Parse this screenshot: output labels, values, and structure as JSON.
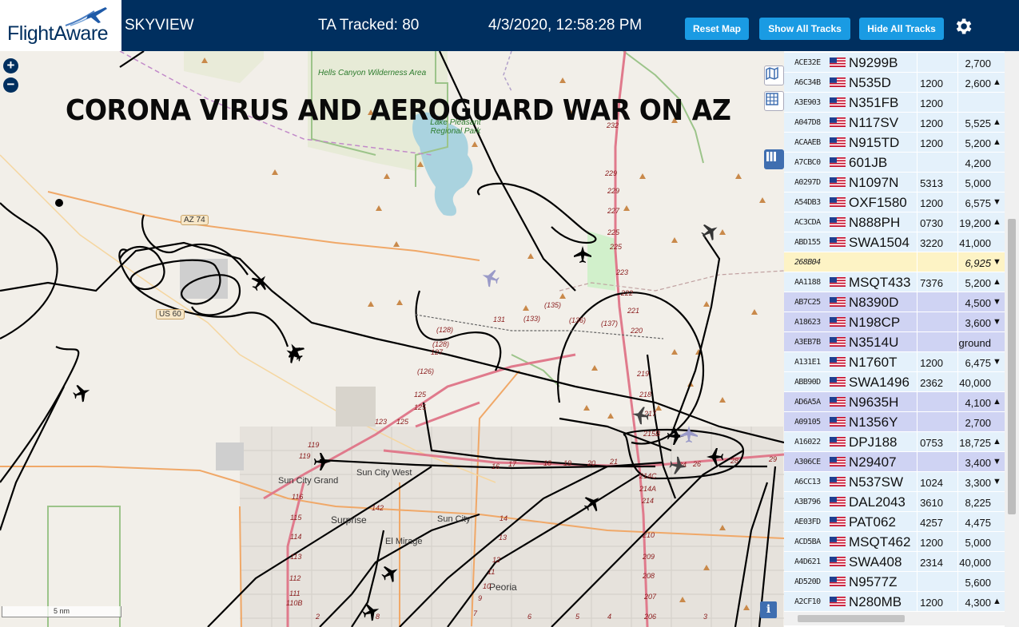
{
  "header": {
    "brand": "FlightAware",
    "app_name": "SKYVIEW",
    "tracked": "TA Tracked: 80",
    "datetime": "4/3/2020, 12:58:28 PM",
    "buttons": {
      "reset": "Reset Map",
      "show": "Show All Tracks",
      "hide": "Hide All Tracks"
    },
    "settings_icon": "gear-icon",
    "colors": {
      "bar": "#002f5f",
      "button": "#1a9be3"
    }
  },
  "map": {
    "overlay_title": "CORONA VIRUS AND AEROGUARD WAR ON AZ",
    "zoom_in": "+",
    "zoom_out": "−",
    "scale_label": "5 nm",
    "info_label": "i",
    "places": {
      "hells_canyon": "Hells Canyon Wilderness Area",
      "lake_pleasant": "Lake Pleasant Regional Park",
      "sun_city_grand": "Sun City Grand",
      "sun_city_west": "Sun City West",
      "sun_city": "Sun City",
      "surprise": "Surprise",
      "el_mirage": "El Mirage",
      "peoria": "Peoria"
    },
    "shields": {
      "az74": "AZ 74",
      "us60": "US 60"
    },
    "route_numbers": {
      "r232": "232",
      "r229a": "229",
      "r229b": "229",
      "r227": "227",
      "r225a": "225",
      "r225b": "225",
      "r223": "223",
      "r222": "222",
      "r221": "221",
      "r220": "220",
      "r219": "219",
      "r218": "218",
      "r217": "217",
      "r215b": "215B",
      "r214c": "214C",
      "r214a": "214A",
      "r214": "214",
      "r210": "210",
      "r209": "209",
      "r208": "208",
      "r207": "207",
      "r206": "206",
      "r133": "(133)",
      "r135": "(135)",
      "r136": "(136)",
      "r131": "131",
      "r137": "(137)",
      "r128": "(128)",
      "r128b": "(128)",
      "r127": "127",
      "r126": "(126)",
      "r125a": "125",
      "r125b": "125",
      "r123": "123",
      "r124": "125",
      "r119a": "119",
      "r119b": "119",
      "r116": "116",
      "r115": "115",
      "r114": "114",
      "r113": "113",
      "r112": "112",
      "r111": "111",
      "r110": "110B",
      "r142": "142",
      "r14": "14",
      "r12": "12",
      "r13": "13",
      "r11": "11",
      "r10": "10",
      "r9": "9",
      "r8": "8",
      "r7": "7",
      "r6": "6",
      "r5": "5",
      "r4": "4",
      "r3": "3",
      "r2": "2",
      "r17": "17",
      "r18": "18",
      "r19": "19",
      "r20": "20",
      "r21": "21",
      "r16": "16",
      "r24": "24",
      "r26": "26",
      "r28": "28",
      "r29": "29"
    },
    "icons": {
      "layers": "map-layers-icon",
      "grid": "grid-icon",
      "columns": "columns-icon",
      "aircraft": "airplane-icon"
    }
  },
  "aircraft_list": {
    "rows": [
      {
        "hex": "ACE32E",
        "ident": "N9299B",
        "squawk": "",
        "altitude": "2,700",
        "trend": "",
        "state": "normal"
      },
      {
        "hex": "A6C34B",
        "ident": "N535D",
        "squawk": "1200",
        "altitude": "2,600",
        "trend": "▲",
        "state": "normal"
      },
      {
        "hex": "A3E903",
        "ident": "N351FB",
        "squawk": "1200",
        "altitude": "",
        "trend": "",
        "state": "normal"
      },
      {
        "hex": "A047D8",
        "ident": "N117SV",
        "squawk": "1200",
        "altitude": "5,525",
        "trend": "▲",
        "state": "normal"
      },
      {
        "hex": "ACAAEB",
        "ident": "N915TD",
        "squawk": "1200",
        "altitude": "5,200",
        "trend": "▲",
        "state": "normal"
      },
      {
        "hex": "A7CBC0",
        "ident": "601JB",
        "squawk": "",
        "altitude": "4,200",
        "trend": "",
        "state": "normal"
      },
      {
        "hex": "A0297D",
        "ident": "N1097N",
        "squawk": "5313",
        "altitude": "5,000",
        "trend": "",
        "state": "normal"
      },
      {
        "hex": "A54DB3",
        "ident": "OXF1580",
        "squawk": "1200",
        "altitude": "6,575",
        "trend": "▼",
        "state": "normal"
      },
      {
        "hex": "AC3CDA",
        "ident": "N888PH",
        "squawk": "0730",
        "altitude": "19,200",
        "trend": "▲",
        "state": "normal"
      },
      {
        "hex": "ABD155",
        "ident": "SWA1504",
        "squawk": "3220",
        "altitude": "41,000",
        "trend": "",
        "state": "normal"
      },
      {
        "hex": "268B04",
        "ident": "",
        "squawk": "",
        "altitude": "6,925",
        "trend": "▼",
        "state": "hl"
      },
      {
        "hex": "AA1188",
        "ident": "MSQT433",
        "squawk": "7376",
        "altitude": "5,200",
        "trend": "▲",
        "state": "normal"
      },
      {
        "hex": "AB7C25",
        "ident": "N8390D",
        "squawk": "",
        "altitude": "4,500",
        "trend": "▼",
        "state": "sel"
      },
      {
        "hex": "A18623",
        "ident": "N198CP",
        "squawk": "",
        "altitude": "3,600",
        "trend": "▼",
        "state": "sel"
      },
      {
        "hex": "A3EB7B",
        "ident": "N3514U",
        "squawk": "",
        "altitude": "ground",
        "trend": "",
        "state": "sel"
      },
      {
        "hex": "A131E1",
        "ident": "N1760T",
        "squawk": "1200",
        "altitude": "6,475",
        "trend": "▼",
        "state": "normal"
      },
      {
        "hex": "ABB90D",
        "ident": "SWA1496",
        "squawk": "2362",
        "altitude": "40,000",
        "trend": "",
        "state": "normal"
      },
      {
        "hex": "AD6A5A",
        "ident": "N9635H",
        "squawk": "",
        "altitude": "4,100",
        "trend": "▲",
        "state": "sel"
      },
      {
        "hex": "A09105",
        "ident": "N1356Y",
        "squawk": "",
        "altitude": "2,700",
        "trend": "",
        "state": "sel"
      },
      {
        "hex": "A16022",
        "ident": "DPJ188",
        "squawk": "0753",
        "altitude": "18,725",
        "trend": "▲",
        "state": "normal"
      },
      {
        "hex": "A306CE",
        "ident": "N29407",
        "squawk": "",
        "altitude": "3,400",
        "trend": "▼",
        "state": "sel"
      },
      {
        "hex": "A6CC13",
        "ident": "N537SW",
        "squawk": "1024",
        "altitude": "3,300",
        "trend": "▼",
        "state": "normal"
      },
      {
        "hex": "A3B796",
        "ident": "DAL2043",
        "squawk": "3610",
        "altitude": "8,225",
        "trend": "",
        "state": "normal"
      },
      {
        "hex": "AE03FD",
        "ident": "PAT062",
        "squawk": "4257",
        "altitude": "4,475",
        "trend": "",
        "state": "normal"
      },
      {
        "hex": "ACD5BA",
        "ident": "MSQT462",
        "squawk": "1200",
        "altitude": "5,000",
        "trend": "",
        "state": "normal"
      },
      {
        "hex": "A4D621",
        "ident": "SWA408",
        "squawk": "2314",
        "altitude": "40,000",
        "trend": "",
        "state": "normal"
      },
      {
        "hex": "AD520D",
        "ident": "N9577Z",
        "squawk": "",
        "altitude": "5,600",
        "trend": "",
        "state": "normal"
      },
      {
        "hex": "A2CF10",
        "ident": "N280MB",
        "squawk": "1200",
        "altitude": "4,300",
        "trend": "▲",
        "state": "normal"
      }
    ],
    "colors": {
      "row": "#e4f1fb",
      "selected": "#cfd3f3",
      "highlight": "#fdf3c5"
    }
  }
}
